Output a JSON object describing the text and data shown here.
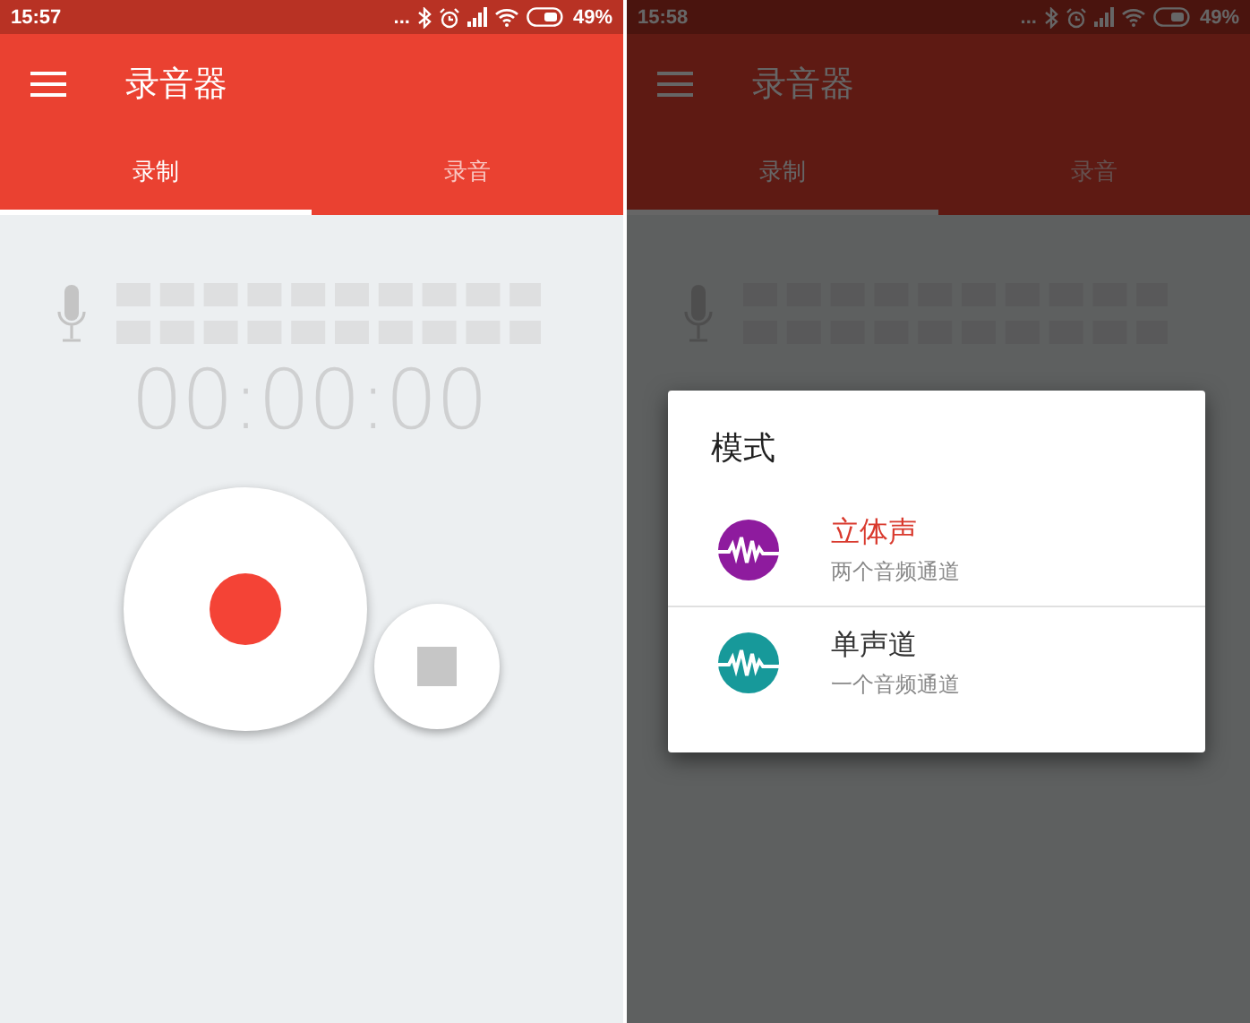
{
  "screens": [
    {
      "status_bar": {
        "time": "15:57",
        "dots": "...",
        "battery_text": "49%"
      },
      "app_bar": {
        "title": "录音器"
      },
      "tabs": [
        {
          "label": "录制",
          "selected": true
        },
        {
          "label": "录音",
          "selected": false
        }
      ],
      "timer": "00:00:00",
      "dimmed": false
    },
    {
      "status_bar": {
        "time": "15:58",
        "dots": "...",
        "battery_text": "49%"
      },
      "app_bar": {
        "title": "录音器"
      },
      "tabs": [
        {
          "label": "录制",
          "selected": true
        },
        {
          "label": "录音",
          "selected": false
        }
      ],
      "dimmed": true,
      "dialog": {
        "title": "模式",
        "items": [
          {
            "title": "立体声",
            "subtitle": "两个音频通道",
            "selected": true,
            "color": "#8e1b9e"
          },
          {
            "title": "单声道",
            "subtitle": "一个音频通道",
            "selected": false,
            "color": "#17999a"
          }
        ]
      }
    }
  ]
}
